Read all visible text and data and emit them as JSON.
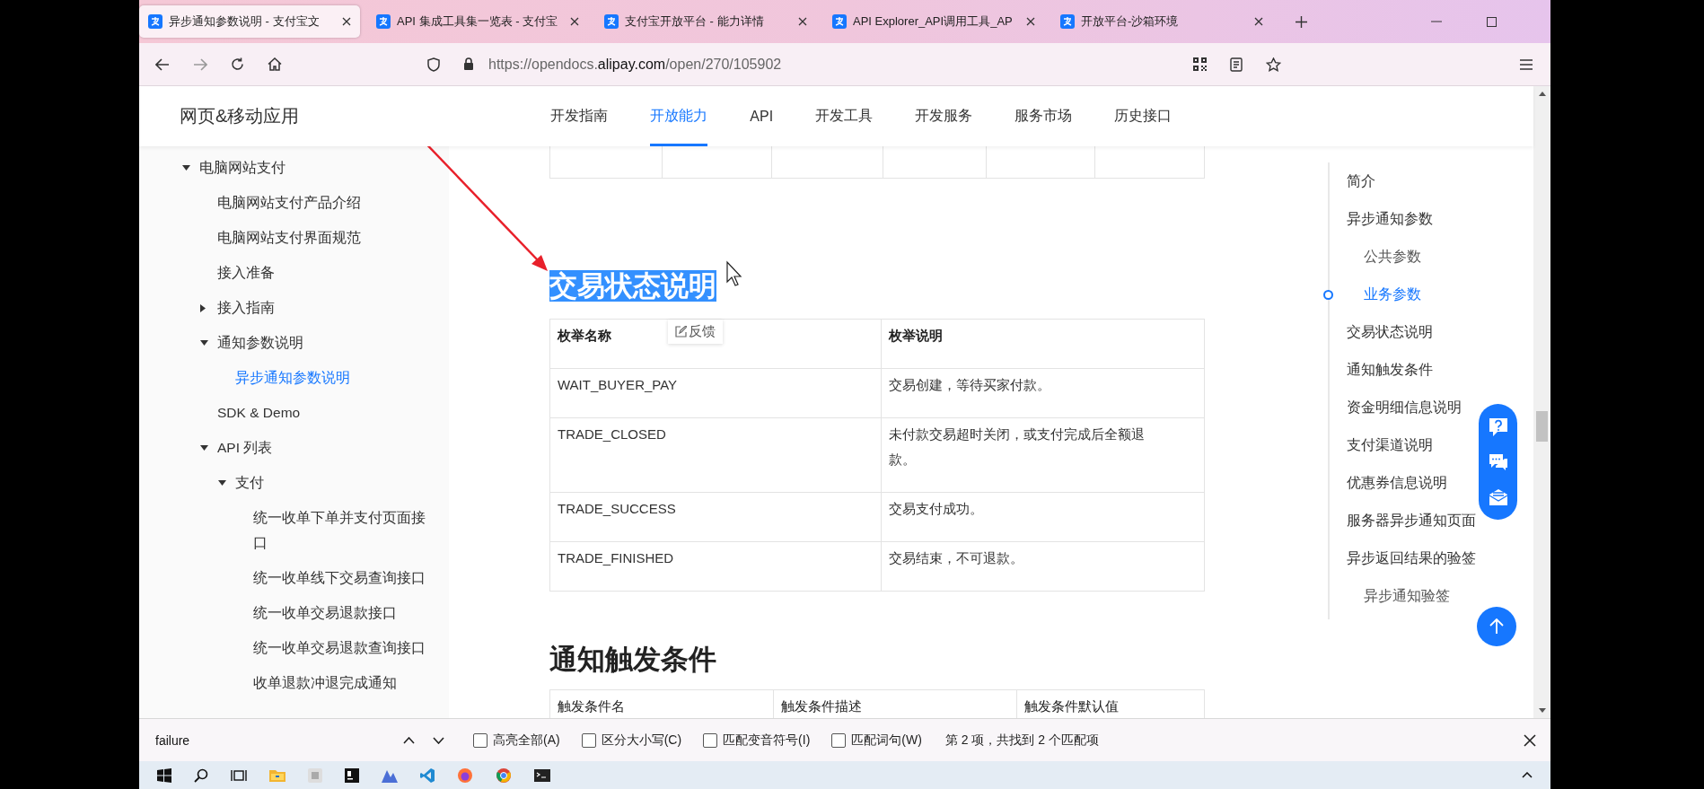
{
  "browser": {
    "tabs": [
      {
        "title": "异步通知参数说明 - 支付宝文",
        "selected": true
      },
      {
        "title": "API 集成工具集一览表 - 支付宝",
        "selected": false
      },
      {
        "title": "支付宝开放平台 - 能力详情",
        "selected": false
      },
      {
        "title": "API Explorer_API调用工具_AP",
        "selected": false
      },
      {
        "title": "开放平台-沙箱环境",
        "selected": false
      }
    ],
    "url": [
      {
        "text": "https://opendocs.",
        "emphasis": false
      },
      {
        "text": "alipay.com",
        "emphasis": true
      },
      {
        "text": "/open/270/105902",
        "emphasis": false
      }
    ]
  },
  "site_header": {
    "title": "网页&移动应用",
    "nav": [
      {
        "label": "开发指南",
        "selected": false
      },
      {
        "label": "开放能力",
        "selected": true
      },
      {
        "label": "API",
        "selected": false
      },
      {
        "label": "开发工具",
        "selected": false
      },
      {
        "label": "开发服务",
        "selected": false
      },
      {
        "label": "服务市场",
        "selected": false
      },
      {
        "label": "历史接口",
        "selected": false
      }
    ]
  },
  "sidebar": {
    "items": [
      {
        "label": "电脑网站支付",
        "selected": false,
        "expanded": true,
        "children": [
          {
            "label": "电脑网站支付产品介绍",
            "selected": false
          },
          {
            "label": "电脑网站支付界面规范",
            "selected": false
          },
          {
            "label": "接入准备",
            "selected": false
          },
          {
            "label": "接入指南",
            "selected": false,
            "expanded": false
          },
          {
            "label": "通知参数说明",
            "selected": false,
            "expanded": true,
            "children": [
              {
                "label": "异步通知参数说明",
                "selected": true
              }
            ]
          },
          {
            "label": "SDK & Demo",
            "selected": false
          },
          {
            "label": "API 列表",
            "selected": false,
            "expanded": true,
            "children": [
              {
                "label": "支付",
                "selected": false,
                "expanded": true,
                "children": [
                  {
                    "label": "统一收单下单并支付页面接口",
                    "selected": false
                  },
                  {
                    "label": "统一收单线下交易查询接口",
                    "selected": false
                  },
                  {
                    "label": "统一收单交易退款接口",
                    "selected": false
                  },
                  {
                    "label": "统一收单交易退款查询接口",
                    "selected": false
                  },
                  {
                    "label": "收单退款冲退完成通知",
                    "selected": false
                  }
                ]
              }
            ]
          }
        ]
      }
    ]
  },
  "article": {
    "sections": [
      {
        "heading": "交易状态说明",
        "highlighted": true,
        "feedback": "反馈",
        "table": {
          "columns": [
            "枚举名称",
            "枚举说明"
          ],
          "rows": [
            [
              "WAIT_BUYER_PAY",
              "交易创建，等待买家付款。"
            ],
            [
              "TRADE_CLOSED",
              "未付款交易超时关闭，或支付完成后全额退款。"
            ],
            [
              "TRADE_SUCCESS",
              "交易支付成功。"
            ],
            [
              "TRADE_FINISHED",
              "交易结束，不可退款。"
            ]
          ]
        }
      },
      {
        "heading": "通知触发条件",
        "highlighted": false,
        "table": {
          "columns": [
            "触发条件名",
            "触发条件描述",
            "触发条件默认值"
          ]
        }
      }
    ]
  },
  "toc": {
    "items": [
      {
        "label": "简介",
        "selected": false
      },
      {
        "label": "异步通知参数",
        "selected": false,
        "children": [
          {
            "label": "公共参数",
            "selected": false
          },
          {
            "label": "业务参数",
            "selected": true
          }
        ]
      },
      {
        "label": "交易状态说明",
        "selected": false
      },
      {
        "label": "通知触发条件",
        "selected": false
      },
      {
        "label": "资金明细信息说明",
        "selected": false
      },
      {
        "label": "支付渠道说明",
        "selected": false
      },
      {
        "label": "优惠券信息说明",
        "selected": false
      },
      {
        "label": "服务器异步通知页面",
        "selected": false
      },
      {
        "label": "异步返回结果的验签",
        "selected": false,
        "children": [
          {
            "label": "异步通知验签",
            "selected": false
          }
        ]
      }
    ]
  },
  "find_bar": {
    "query": "failure",
    "options": [
      {
        "label": "高亮全部(A)",
        "checked": false
      },
      {
        "label": "区分大小写(C)",
        "checked": false
      },
      {
        "label": "匹配变音符号(I)",
        "checked": false
      },
      {
        "label": "匹配词句(W)",
        "checked": false
      }
    ],
    "result": "第 2 项，共找到 2 个匹配项"
  }
}
